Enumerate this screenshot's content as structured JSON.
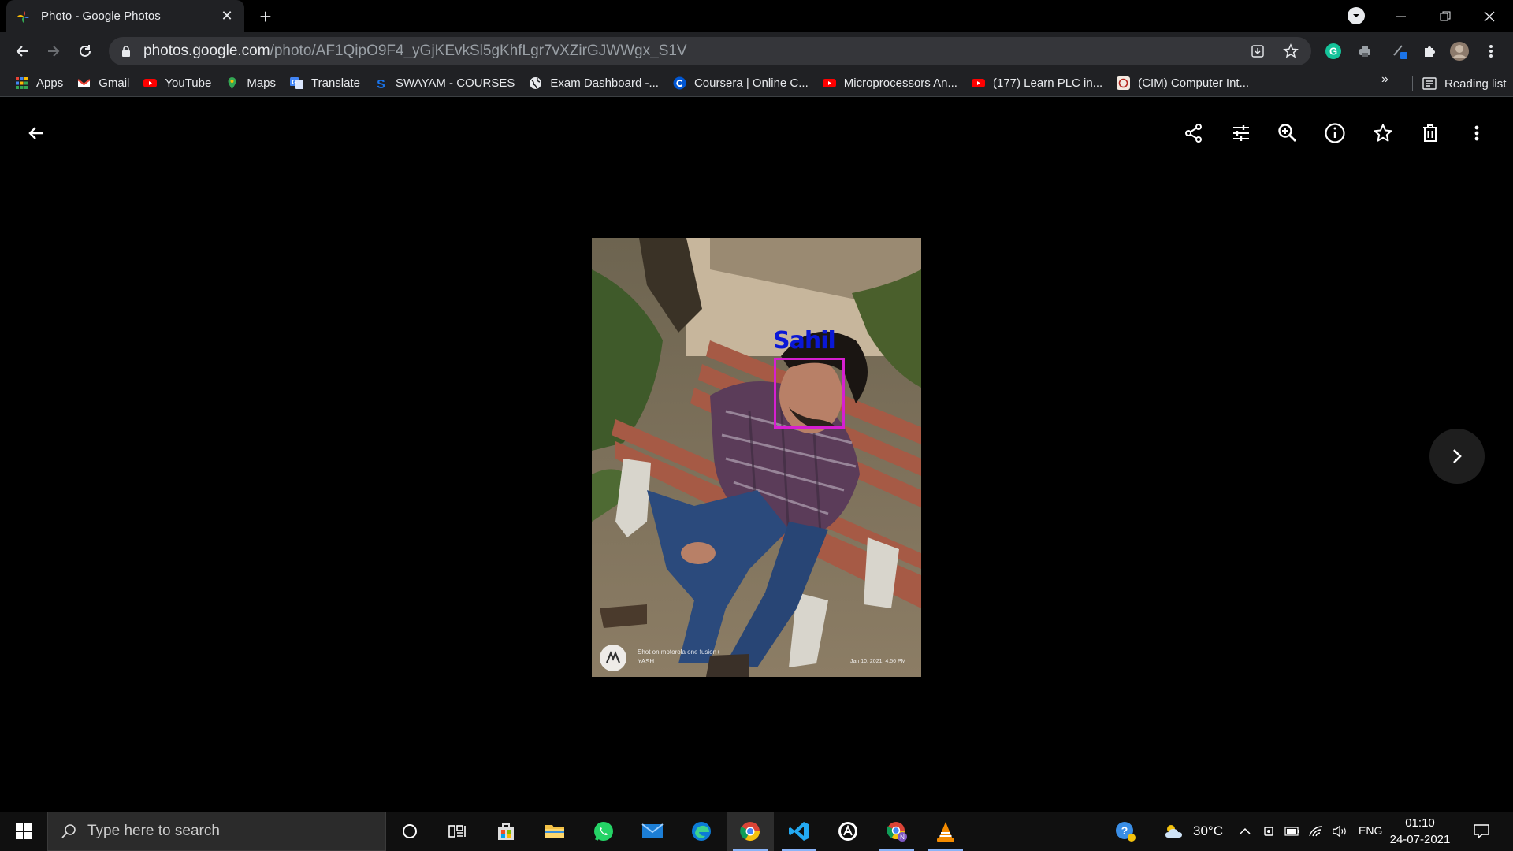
{
  "browser": {
    "tab": {
      "title": "Photo - Google Photos"
    },
    "url": {
      "host": "photos.google.com",
      "path": "/photo/AF1QipO9F4_yGjKEvkSl5gKhfLgr7vXZirGJWWgx_S1V"
    },
    "bookmarks": [
      {
        "label": "Apps",
        "icon": "apps-grid-icon"
      },
      {
        "label": "Gmail",
        "icon": "gmail-icon"
      },
      {
        "label": "YouTube",
        "icon": "youtube-icon"
      },
      {
        "label": "Maps",
        "icon": "maps-icon"
      },
      {
        "label": "Translate",
        "icon": "translate-icon"
      },
      {
        "label": "SWAYAM - COURSES",
        "icon": "swayam-icon"
      },
      {
        "label": "Exam Dashboard -...",
        "icon": "globe-icon"
      },
      {
        "label": "Coursera | Online C...",
        "icon": "coursera-icon"
      },
      {
        "label": "Microprocessors An...",
        "icon": "youtube-icon"
      },
      {
        "label": "(177) Learn PLC in...",
        "icon": "youtube-icon"
      },
      {
        "label": "(CIM) Computer Int...",
        "icon": "cim-icon"
      }
    ],
    "bookmarks_more": "»",
    "reading_list": "Reading list"
  },
  "viewer": {
    "toolbar_icons": [
      "share-icon",
      "edit-adjust-icon",
      "zoom-icon",
      "info-icon",
      "favorite-star-icon",
      "delete-icon",
      "more-options-icon"
    ],
    "photo": {
      "face_label": "Sahil",
      "watermark_line1": "Shot on motorola one fusion+",
      "watermark_line2": "YASH",
      "timestamp": "Jan 10, 2021, 4:56 PM"
    }
  },
  "taskbar": {
    "search_placeholder": "Type here to search",
    "weather": "30°C",
    "language": "ENG",
    "time": "01:10",
    "date": "24-07-2021",
    "apps": [
      "cortana-icon",
      "task-view-icon",
      "store-icon",
      "file-explorer-icon",
      "whatsapp-icon",
      "mail-icon",
      "edge-icon",
      "chrome-icon",
      "vscode-icon",
      "app-icon",
      "chrome-profile-icon",
      "vlc-icon"
    ]
  },
  "colors": {
    "browser_chrome": "#202124",
    "face_label": "#0a18d6",
    "face_box": "#d61fd0",
    "taskbar": "#101010"
  }
}
